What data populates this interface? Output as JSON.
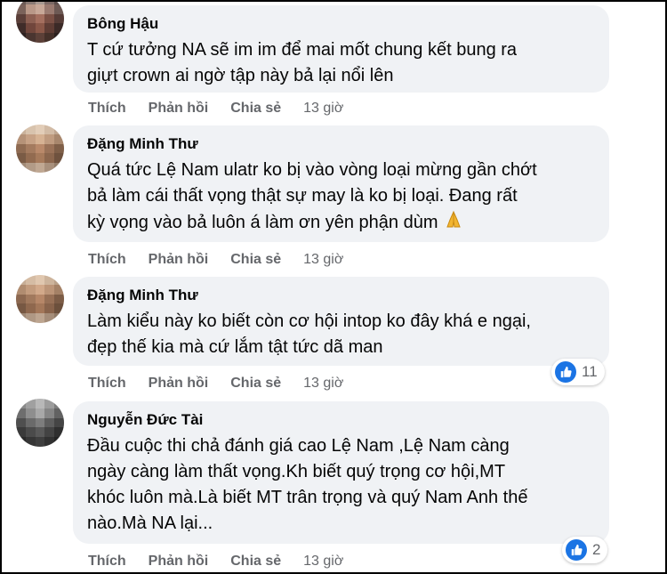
{
  "comments": [
    {
      "author": "Bông Hậu",
      "text": "T cứ tưởng NA sẽ im im để mai mốt chung kết bung ra\ngiựt crown ai ngờ tập này bả lại nổi lên",
      "actions": {
        "like": "Thích",
        "reply": "Phản hồi",
        "share": "Chia sẻ",
        "time": "13 giờ"
      }
    },
    {
      "author": "Đặng Minh Thư",
      "text": "Quá tức Lệ Nam ulatr ko bị vào vòng loại mừng gần chớt\nbả làm cái thất vọng thật sự may là ko bị loại. Đang rất\nkỳ vọng vào bả luôn á làm ơn yên phận dùm",
      "emoji": "folded-hands-icon",
      "actions": {
        "like": "Thích",
        "reply": "Phản hồi",
        "share": "Chia sẻ",
        "time": "13 giờ"
      }
    },
    {
      "author": "Đặng Minh Thư",
      "text": "Làm kiểu này ko biết còn cơ hội intop ko đây khá e ngại,\nđẹp thế kia mà cứ lắm tật tức dã man",
      "reaction_count": "11",
      "actions": {
        "like": "Thích",
        "reply": "Phản hồi",
        "share": "Chia sẻ",
        "time": "13 giờ"
      }
    },
    {
      "author": "Nguyễn Đức Tài",
      "text": "Đầu cuộc thi chả đánh giá cao Lệ Nam ,Lệ Nam càng\nngày càng làm thất vọng.Kh biết quý trọng cơ hội,MT\nkhóc luôn mà.Là biết MT trân trọng và quý Nam Anh thế\nnào.Mà NA lại...",
      "reaction_count": "2",
      "actions": {
        "like": "Thích",
        "reply": "Phản hồi",
        "share": "Chia sẻ",
        "time": "13 giờ"
      }
    }
  ],
  "colors": {
    "bubble": "#f0f2f5",
    "meta_text": "#65676b",
    "like_blue": "#1b74e4"
  }
}
